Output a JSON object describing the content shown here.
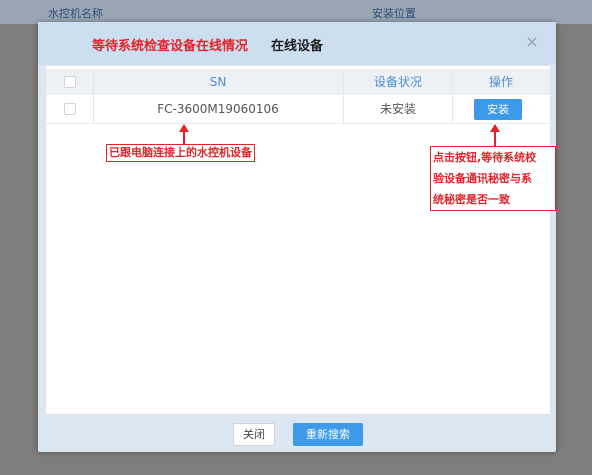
{
  "background": {
    "columns": [
      "水控机名称",
      "安装位置"
    ]
  },
  "dialog": {
    "annotation_title": "等待系统检查设备在线情况",
    "title": "在线设备",
    "close_icon": "×"
  },
  "table": {
    "headers": {
      "sn": "SN",
      "status": "设备状况",
      "operation": "操作"
    },
    "rows": [
      {
        "sn": "FC-3600M19060106",
        "status": "未安装",
        "action": "安装"
      }
    ]
  },
  "annotations": {
    "device_note": "已跟电脑连接上的水控机设备",
    "install_note": [
      "点击按钮,等待系统校",
      "验设备通讯秘密与系",
      "统秘密是否一致"
    ]
  },
  "footer": {
    "close_label": "关闭",
    "refresh_label": "重新搜索"
  },
  "colors": {
    "accent": "#3c9ae8",
    "annotation": "#e0242b",
    "header_bg": "#ccdff1"
  }
}
